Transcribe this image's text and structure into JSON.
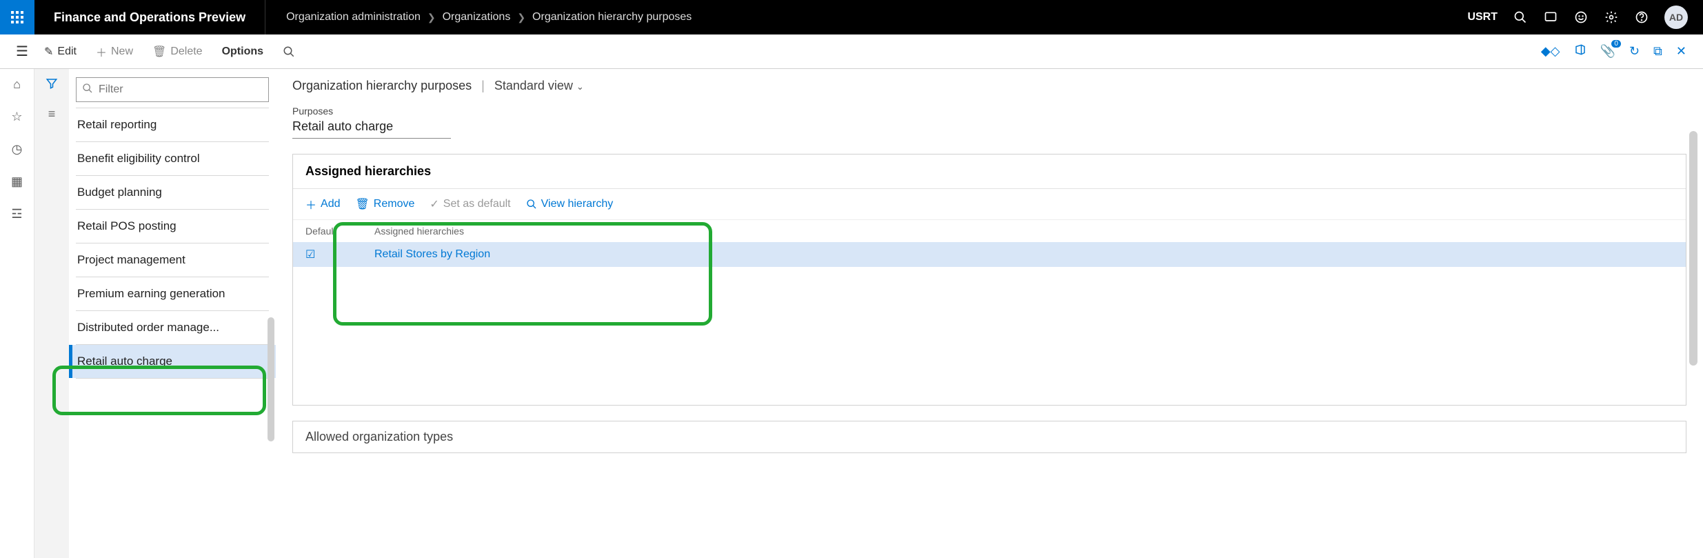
{
  "header": {
    "app_title": "Finance and Operations Preview",
    "breadcrumb": [
      "Organization administration",
      "Organizations",
      "Organization hierarchy purposes"
    ],
    "company": "USRT",
    "avatar": "AD"
  },
  "actionbar": {
    "edit": "Edit",
    "new": "New",
    "delete": "Delete",
    "options": "Options"
  },
  "filter": {
    "placeholder": "Filter"
  },
  "list": {
    "items": [
      "Retail reporting",
      "Benefit eligibility control",
      "Budget planning",
      "Retail POS posting",
      "Project management",
      "Premium earning generation",
      "Distributed order manage...",
      "Retail auto charge"
    ],
    "selected_index": 7
  },
  "main": {
    "title": "Organization hierarchy purposes",
    "view": "Standard view",
    "purposes_label": "Purposes",
    "purposes_value": "Retail auto charge",
    "assigned_section_title": "Assigned hierarchies",
    "toolbar": {
      "add": "Add",
      "remove": "Remove",
      "set_default": "Set as default",
      "view_hierarchy": "View hierarchy"
    },
    "grid_headers": {
      "default": "Default",
      "assigned": "Assigned hierarchies"
    },
    "rows": [
      {
        "default": true,
        "name": "Retail Stores by Region"
      }
    ],
    "bottom_section": "Allowed organization types"
  }
}
